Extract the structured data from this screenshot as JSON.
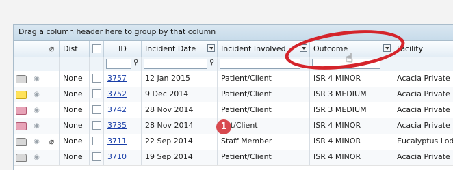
{
  "group_bar": {
    "text": "Drag a column header here to group by that column"
  },
  "columns": {
    "dist": "Dist",
    "id": "ID",
    "incident_date": "Incident Date",
    "incident_involved": "Incident Involved",
    "outcome": "Outcome",
    "facility": "Facility"
  },
  "rows": [
    {
      "envelope": "grey",
      "attachment": false,
      "dist": "None",
      "id": "3757",
      "date": "12 Jan 2015",
      "involved": "Patient/Client",
      "outcome": "ISR 4 MINOR",
      "facility": "Acacia Private"
    },
    {
      "envelope": "yellow",
      "attachment": false,
      "dist": "None",
      "id": "3752",
      "date": "9 Dec 2014",
      "involved": "Patient/Client",
      "outcome": "ISR 3 MEDIUM",
      "facility": "Acacia Private"
    },
    {
      "envelope": "pink",
      "attachment": false,
      "dist": "None",
      "id": "3742",
      "date": "28 Nov 2014",
      "involved": "Patient/Client",
      "outcome": "ISR 3 MEDIUM",
      "facility": "Acacia Private"
    },
    {
      "envelope": "pink",
      "attachment": false,
      "dist": "None",
      "id": "3735",
      "date": "28 Nov 2014",
      "involved": "ent/Client",
      "outcome": "ISR 4 MINOR",
      "facility": "Acacia Private"
    },
    {
      "envelope": "grey",
      "attachment": true,
      "dist": "None",
      "id": "3711",
      "date": "22 Sep 2014",
      "involved": "Staff Member",
      "outcome": "ISR 4 MINOR",
      "facility": "Eucalyptus Lodge"
    },
    {
      "envelope": "grey",
      "attachment": false,
      "dist": "None",
      "id": "3710",
      "date": "19 Sep 2014",
      "involved": "Patient/Client",
      "outcome": "ISR 4 MINOR",
      "facility": "Acacia Private"
    }
  ],
  "annotation": {
    "step_number": "1"
  }
}
